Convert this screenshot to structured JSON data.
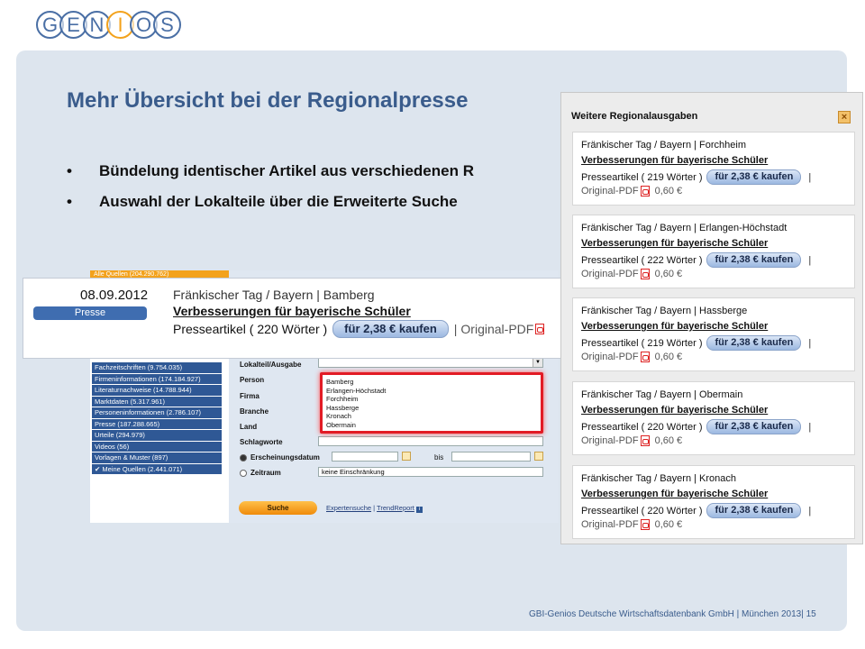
{
  "logo": {
    "letters": [
      "G",
      "E",
      "N",
      "I",
      "O",
      "S"
    ]
  },
  "slide": {
    "title": "Mehr Übersicht bei der Regionalpresse",
    "bullets": [
      "Bündelung identischer Artikel aus verschiedenen R",
      "Auswahl der Lokalteile über die Erweiterte Suche"
    ],
    "footer": "GBI-Genios Deutsche Wirtschaftsdatenbank GmbH | München 2013| 15"
  },
  "search_screenshot": {
    "top_bar": "Alle Quellen (204.290.762)",
    "nav_items": [
      "Fachzeitschriften (9.754.035)",
      "Firmeninformationen (174.184.927)",
      "Literaturnachweise (14.788.944)",
      "Marktdaten (5.317.961)",
      "Personeninformationen (2.786.107)",
      "Presse (187.288.665)",
      "Urteile (294.979)",
      "Videos (56)",
      "Vorlagen & Muster (897)",
      "Meine Quellen (2.441.071)"
    ],
    "fields": {
      "lokalteil": "Lokalteil/Ausgabe",
      "person": "Person",
      "firma": "Firma",
      "branche": "Branche",
      "land": "Land",
      "schlagworte": "Schlagworte",
      "erscheinungsdatum": "Erscheinungsdatum",
      "bis": "bis",
      "zeitraum": "Zeitraum",
      "zeitraum_value": "keine Einschränkung"
    },
    "listbox_options": [
      "Bamberg",
      "Erlangen-Höchstadt",
      "Forchheim",
      "Hassberge",
      "Kronach",
      "Obermain"
    ],
    "search_button": "Suche",
    "links": {
      "expert": "Expertensuche",
      "sep": "|",
      "trend": "TrendReport"
    }
  },
  "zoom_card": {
    "date": "08.09.2012",
    "category": "Presse",
    "source": "Fränkischer Tag / Bayern | Bamberg",
    "title": "Verbesserungen für bayerische Schüler",
    "meta": "Presseartikel ( 220 Wörter )",
    "buy_label": "für 2,38 € kaufen",
    "separator": "|",
    "original": "Original-PDF"
  },
  "popup": {
    "heading": "Weitere Regionalausgaben",
    "close": "×",
    "items": [
      {
        "source": "Fränkischer Tag / Bayern | Forchheim",
        "title": "Verbesserungen für bayerische Schüler",
        "meta": "Presseartikel ( 219 Wörter )",
        "buy": "für 2,38 € kaufen",
        "bar": "|",
        "original": "Original-PDF",
        "price": "0,60 €"
      },
      {
        "source": "Fränkischer Tag / Bayern | Erlangen-Höchstadt",
        "title": "Verbesserungen für bayerische Schüler",
        "meta": "Presseartikel ( 222 Wörter )",
        "buy": "für 2,38 € kaufen",
        "bar": "|",
        "original": "Original-PDF",
        "price": "0,60 €"
      },
      {
        "source": "Fränkischer Tag / Bayern | Hassberge",
        "title": "Verbesserungen für bayerische Schüler",
        "meta": "Presseartikel ( 219 Wörter )",
        "buy": "für 2,38 € kaufen",
        "bar": "|",
        "original": "Original-PDF",
        "price": "0,60 €"
      },
      {
        "source": "Fränkischer Tag / Bayern | Obermain",
        "title": "Verbesserungen für bayerische Schüler",
        "meta": "Presseartikel ( 220 Wörter )",
        "buy": "für 2,38 € kaufen",
        "bar": "|",
        "original": "Original-PDF",
        "price": "0,60 €"
      },
      {
        "source": "Fränkischer Tag / Bayern | Kronach",
        "title": "Verbesserungen für bayerische Schüler",
        "meta": "Presseartikel ( 220 Wörter )",
        "buy": "für 2,38 € kaufen",
        "bar": "|",
        "original": "Original-PDF",
        "price": "0,60 €"
      }
    ]
  },
  "colors": {
    "accent": "#3a5c8c",
    "brand_orange": "#f3a21c",
    "highlight_red": "#e21b25",
    "nav_blue": "#2f5895"
  }
}
